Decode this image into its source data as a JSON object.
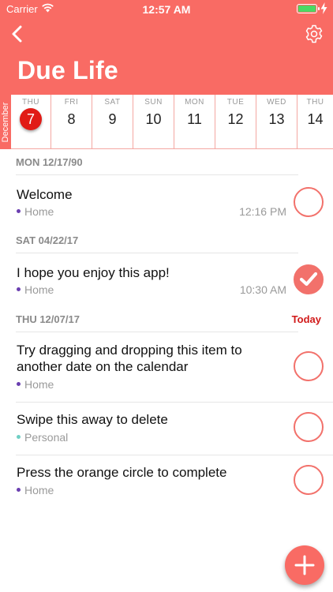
{
  "status": {
    "carrier": "Carrier",
    "time": "12:57 AM"
  },
  "header": {
    "title": "Due Life"
  },
  "calendar": {
    "month": "December",
    "days": [
      {
        "name": "THU",
        "num": "7"
      },
      {
        "name": "FRI",
        "num": "8"
      },
      {
        "name": "SAT",
        "num": "9"
      },
      {
        "name": "SUN",
        "num": "10"
      },
      {
        "name": "MON",
        "num": "11"
      },
      {
        "name": "TUE",
        "num": "12"
      },
      {
        "name": "WED",
        "num": "13"
      },
      {
        "name": "THU",
        "num": "14"
      }
    ]
  },
  "sections": [
    {
      "label": "MON 12/17/90"
    },
    {
      "label": "SAT 04/22/17"
    },
    {
      "label": "THU 12/07/17",
      "badge": "Today"
    }
  ],
  "items": [
    {
      "title": "Welcome",
      "category": "Home",
      "time": "12:16 PM",
      "done": false
    },
    {
      "title": "I hope you enjoy this app!",
      "category": "Home",
      "time": "10:30 AM",
      "done": true
    },
    {
      "title_line1": "Try dragging and dropping this item to",
      "title_line2": "another date on the calendar",
      "category": "Home",
      "done": false
    },
    {
      "title": "Swipe this away to delete",
      "category": "Personal",
      "done": false
    },
    {
      "title": "Press the orange circle to complete",
      "category": "Home",
      "done": false
    }
  ],
  "colors": {
    "accent": "#f96b64",
    "today": "#d11a1a",
    "home_dot": "#6a3fb0",
    "personal_dot": "#6fcfc4"
  }
}
